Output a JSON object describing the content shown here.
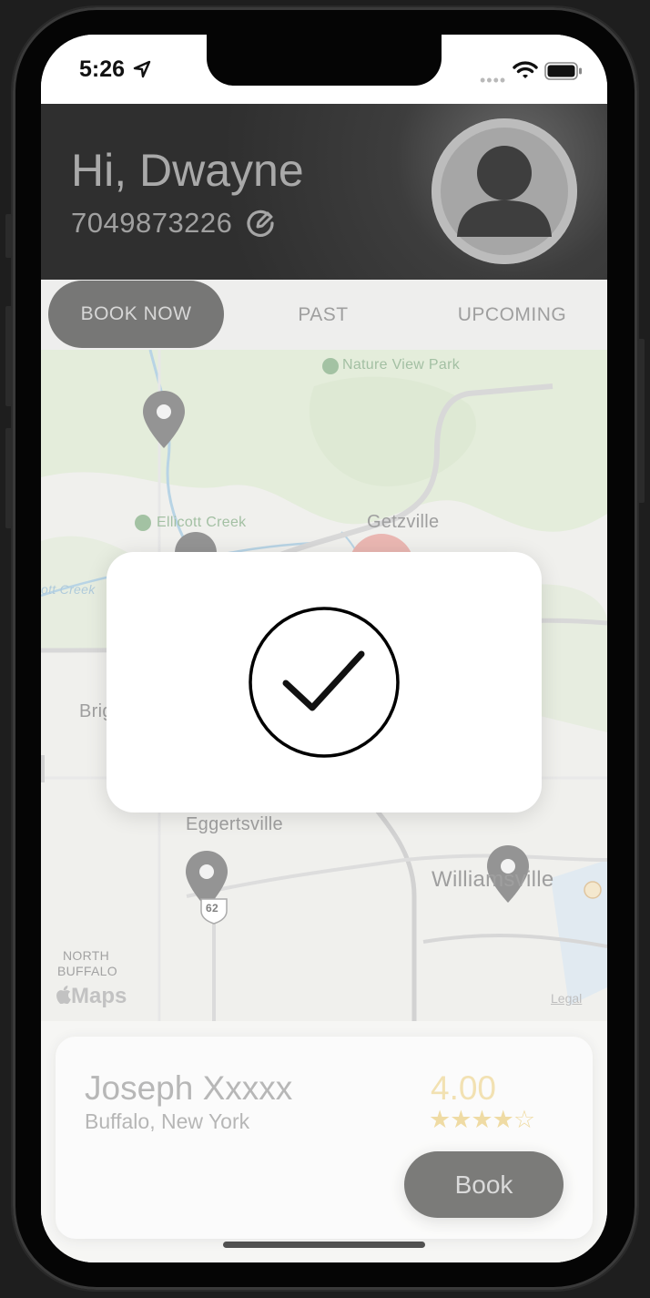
{
  "status_bar": {
    "time": "5:26",
    "signal": "••••"
  },
  "header": {
    "greeting": "Hi, Dwayne",
    "phone_number": "7049873226"
  },
  "tabs": [
    {
      "label": "BOOK NOW",
      "active": true
    },
    {
      "label": "PAST",
      "active": false
    },
    {
      "label": "UPCOMING",
      "active": false
    }
  ],
  "map": {
    "labels": {
      "nature_view_park": "Nature View Park",
      "ellicott_creek": "Ellicott Creek",
      "getzville": "Getzville",
      "ott_creek": "ott Creek",
      "brig": "Brig",
      "eggertsville": "Eggertsville",
      "williamsville": "Williamsville",
      "north": "NORTH",
      "buffalo": "BUFFALO",
      "route": "62"
    },
    "attribution": "Maps",
    "legal": "Legal"
  },
  "provider": {
    "name": "Joseph Xxxxx",
    "location": "Buffalo, New York",
    "rating": "4.00",
    "stars_display": "★★★★☆",
    "book_label": "Book"
  },
  "icons": [
    "location-arrow-icon",
    "wifi-icon",
    "battery-icon",
    "edit-icon",
    "avatar-icon",
    "map-pin-icon",
    "checkmark-icon",
    "apple-logo-icon"
  ],
  "colors": {
    "header_bg": "#3d3d3d",
    "active_tab": "#5a5a58",
    "rating": "#efdba2",
    "book_button": "#5e5e5c"
  }
}
